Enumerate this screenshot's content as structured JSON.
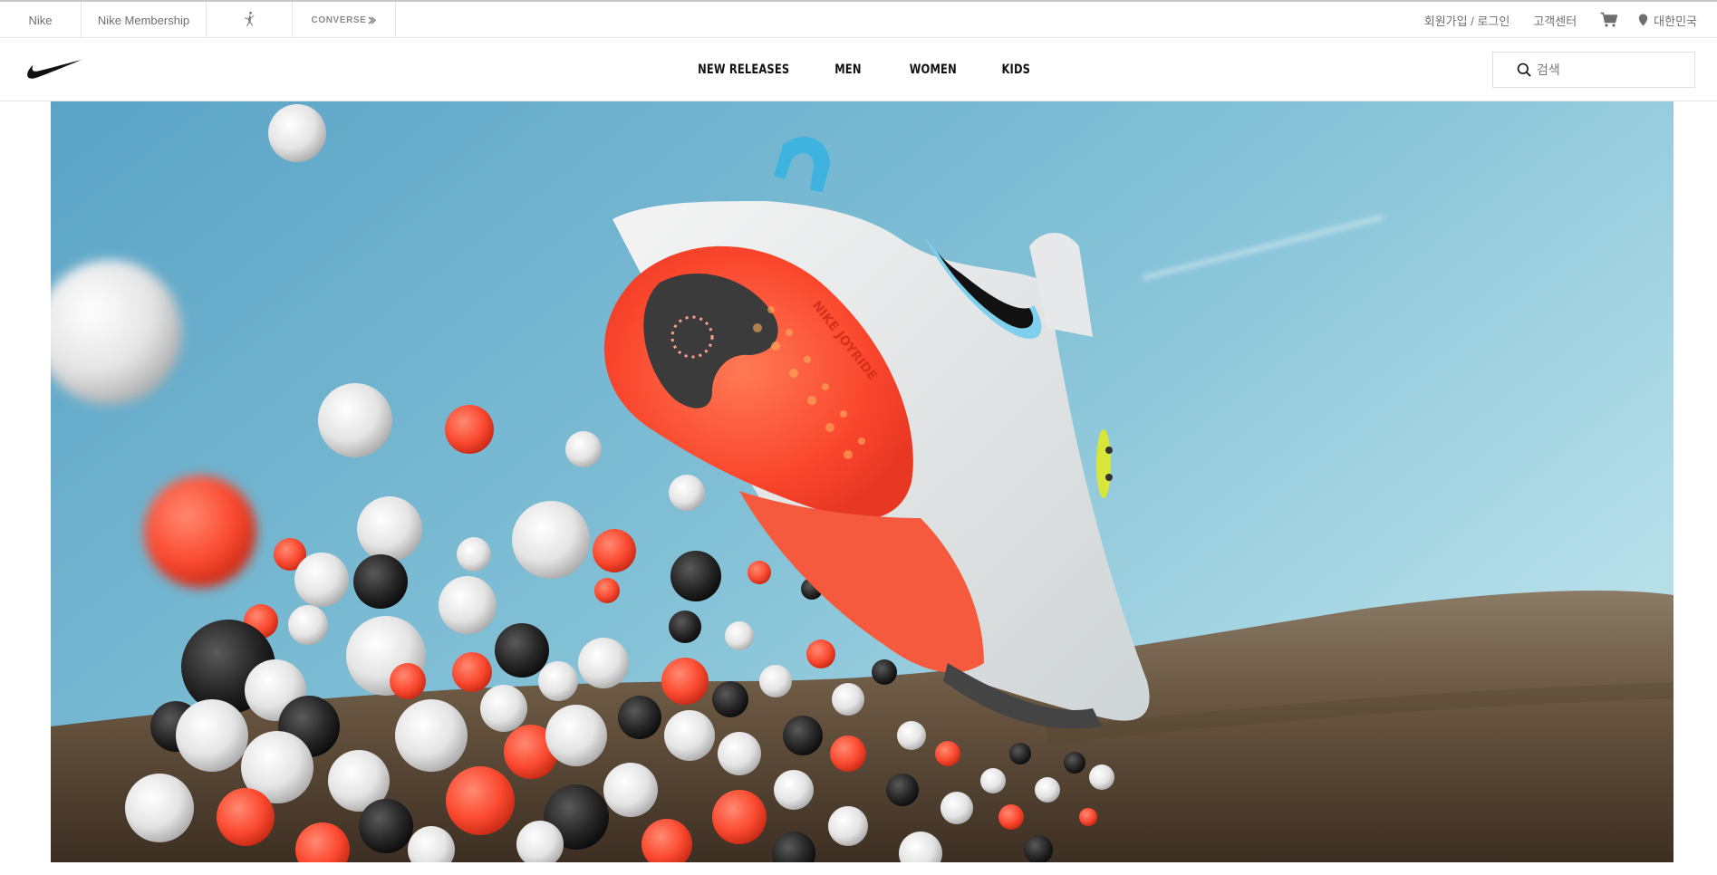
{
  "utility_bar": {
    "tabs": [
      {
        "label": "Nike"
      },
      {
        "label": "Nike Membership"
      },
      {
        "label": "",
        "icon": "jordan-jumpman-icon"
      },
      {
        "label": "CONVERSE",
        "icon": "converse-logo-icon"
      }
    ],
    "join_login": "회원가입 / 로그인",
    "customer_center": "고객센터",
    "cart_icon": "cart-icon",
    "region": {
      "icon": "location-pin-icon",
      "label": "대한민국"
    }
  },
  "main_nav": {
    "logo": "nike-swoosh-icon",
    "menu": [
      {
        "label": "NEW RELEASES"
      },
      {
        "label": "MEN"
      },
      {
        "label": "WOMEN"
      },
      {
        "label": "KIDS"
      }
    ],
    "search": {
      "placeholder": "검색",
      "icon": "search-icon"
    }
  },
  "hero": {
    "description_text": "NIKE JOYRIDE",
    "colors": {
      "sky_top": "#5aa3c6",
      "sky_bottom": "#a9d8e4",
      "ground": "#6e5c48",
      "accent": "#ff4b32"
    }
  }
}
